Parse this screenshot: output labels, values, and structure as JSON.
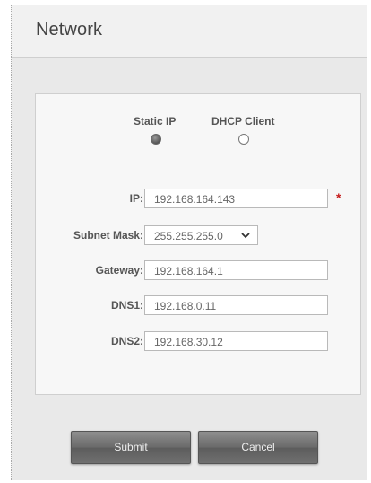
{
  "header": {
    "title": "Network"
  },
  "mode": {
    "static_label": "Static IP",
    "dhcp_label": "DHCP Client",
    "selected": "static"
  },
  "form": {
    "ip_label": "IP:",
    "ip_value": "192.168.164.143",
    "ip_required_mark": "*",
    "subnet_label": "Subnet Mask:",
    "subnet_value": "255.255.255.0",
    "gateway_label": "Gateway:",
    "gateway_value": "192.168.164.1",
    "dns1_label": "DNS1:",
    "dns1_value": "192.168.0.11",
    "dns2_label": "DNS2:",
    "dns2_value": "192.168.30.12"
  },
  "buttons": {
    "submit_label": "Submit",
    "cancel_label": "Cancel"
  },
  "icons": {
    "dropdown": "chevron-down-icon"
  },
  "colors": {
    "required": "#c61d1d",
    "button": "#6a6a6a",
    "background": "#f1f1f1"
  }
}
